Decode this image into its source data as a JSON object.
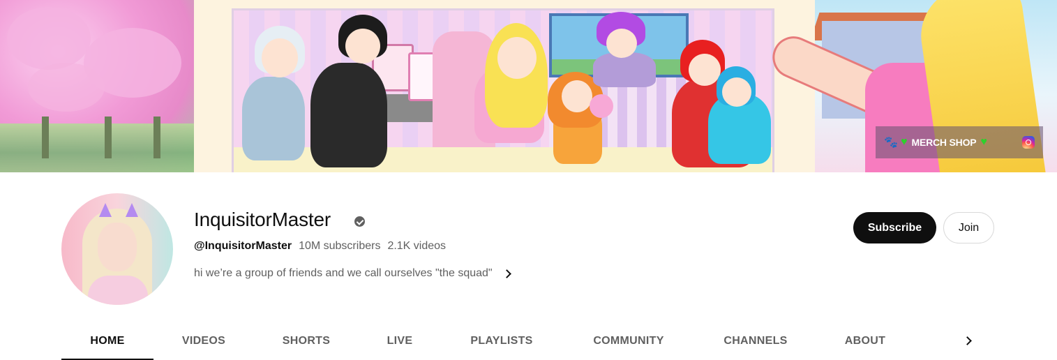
{
  "banner": {
    "links": {
      "merch_label": "MERCH SHOP",
      "paw_icon": "paw-icon",
      "heart_icon": "green-heart-icon",
      "instagram_icon": "instagram-icon",
      "heart_color": "#2cd12c"
    }
  },
  "channel": {
    "name": "InquisitorMaster",
    "verified_icon": "verified-check-icon",
    "handle": "@InquisitorMaster",
    "subscribers": "10M subscribers",
    "videos": "2.1K videos",
    "description": "hi we’re a group of friends and we call ourselves \"the squad\""
  },
  "actions": {
    "subscribe_label": "Subscribe",
    "join_label": "Join"
  },
  "tabs": [
    {
      "label": "HOME",
      "active": true
    },
    {
      "label": "VIDEOS",
      "active": false
    },
    {
      "label": "SHORTS",
      "active": false
    },
    {
      "label": "LIVE",
      "active": false
    },
    {
      "label": "PLAYLISTS",
      "active": false
    },
    {
      "label": "COMMUNITY",
      "active": false
    },
    {
      "label": "CHANNELS",
      "active": false
    },
    {
      "label": "ABOUT",
      "active": false
    }
  ],
  "colors": {
    "subscribe_bg": "#0f0f0f",
    "text_primary": "#0f0f0f",
    "text_secondary": "#606060"
  }
}
